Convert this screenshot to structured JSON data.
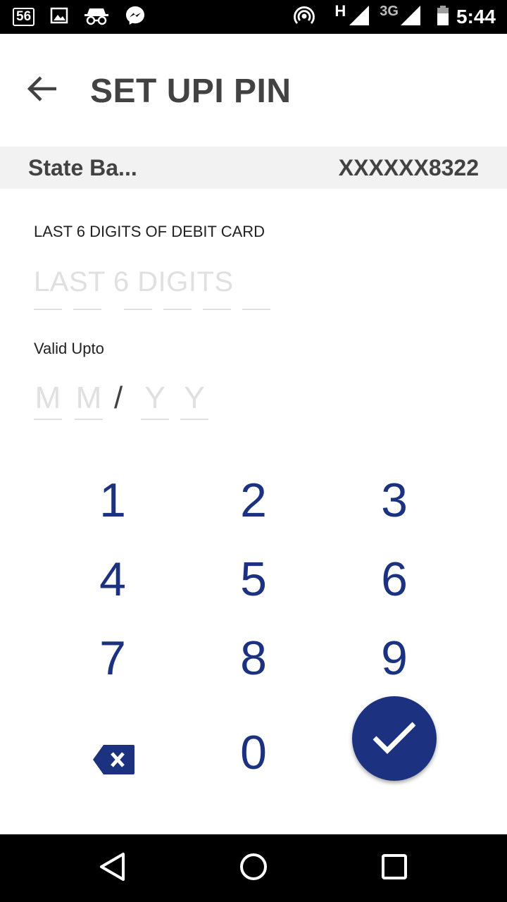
{
  "status_bar": {
    "notification_badge": "56",
    "network_h": "H",
    "network_3g": "3G",
    "time": "5:44"
  },
  "header": {
    "title": "SET UPI PIN",
    "back_icon": "arrow-back-icon"
  },
  "account": {
    "bank_name": "State Ba...",
    "account_number": "XXXXXX8322"
  },
  "form": {
    "card_digits_label": "LAST 6 DIGITS OF DEBIT CARD",
    "card_digits_placeholder": "LAST 6 DIGITS",
    "valid_upto_label": "Valid Upto",
    "expiry": {
      "month_placeholders": [
        "M",
        "M"
      ],
      "separator": "/",
      "year_placeholders": [
        "Y",
        "Y"
      ]
    }
  },
  "keypad": {
    "keys": [
      "1",
      "2",
      "3",
      "4",
      "5",
      "6",
      "7",
      "8",
      "9",
      "0"
    ],
    "backspace_icon": "backspace-icon",
    "submit_icon": "check-icon"
  },
  "nav_bar": {
    "icons": [
      "back-triangle-icon",
      "home-circle-icon",
      "recents-square-icon"
    ]
  },
  "colors": {
    "accent": "#1c3280",
    "title_text": "#424242",
    "account_row_bg": "#f2f2f2",
    "placeholder": "#e0e0e0"
  }
}
